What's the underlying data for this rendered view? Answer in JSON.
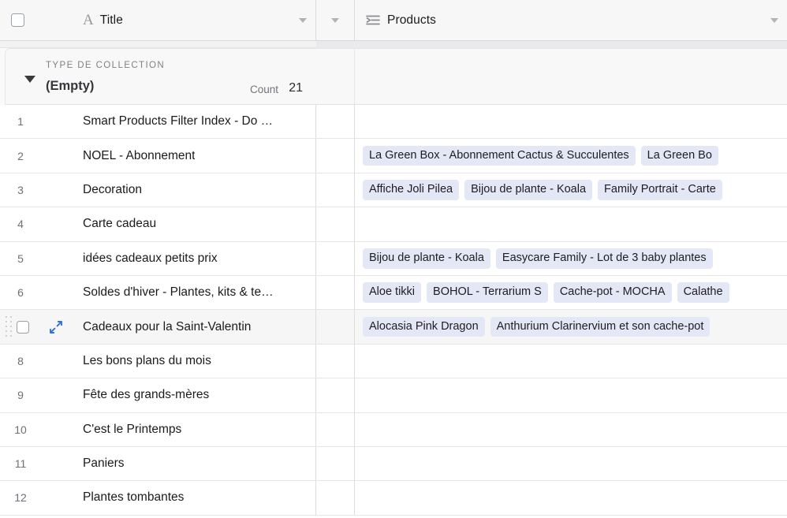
{
  "header": {
    "select_all_checkbox": "select-all",
    "columns": [
      {
        "label": "Title",
        "icon": "text-field-icon",
        "caret": "chevron-down-icon"
      },
      {
        "label": "",
        "icon": "",
        "caret": "chevron-down-icon"
      },
      {
        "label": "Products",
        "icon": "link-record-icon",
        "caret": "chevron-down-icon"
      }
    ]
  },
  "group": {
    "eyebrow": "TYPE DE COLLECTION",
    "value": "(Empty)",
    "count_label": "Count",
    "count_value": "21",
    "toggle": "collapse-triangle-icon"
  },
  "colors": {
    "tag_bg": "#e4e7f5",
    "tag_text": "#1d1d21",
    "accent_blue": "#2f6fe0",
    "row_selected_bg": "#f6f6f7",
    "header_bg": "#f7f7f8",
    "grid_line": "#e6e6e8"
  },
  "rows": [
    {
      "num": "1",
      "title": "Smart Products Filter Index - Do …",
      "selected": false,
      "products": []
    },
    {
      "num": "2",
      "title": "NOEL - Abonnement",
      "selected": false,
      "products": [
        "La Green Box - Abonnement Cactus & Succulentes",
        "La Green Bo"
      ]
    },
    {
      "num": "3",
      "title": "Decoration",
      "selected": false,
      "products": [
        "Affiche Joli Pilea",
        "Bijou de plante - Koala",
        "Family Portrait - Carte"
      ]
    },
    {
      "num": "4",
      "title": "Carte cadeau",
      "selected": false,
      "products": []
    },
    {
      "num": "5",
      "title": "idées cadeaux petits prix",
      "selected": false,
      "products": [
        "Bijou de plante - Koala",
        "Easycare Family - Lot de 3 baby plantes"
      ]
    },
    {
      "num": "6",
      "title": "Soldes d'hiver - Plantes, kits & te…",
      "selected": false,
      "products": [
        "Aloe tikki",
        "BOHOL - Terrarium S",
        "Cache-pot - MOCHA",
        "Calathe"
      ]
    },
    {
      "num": "7",
      "title": "Cadeaux pour la Saint-Valentin",
      "selected": true,
      "products": [
        "Alocasia Pink Dragon",
        "Anthurium Clarinervium et son cache-pot"
      ]
    },
    {
      "num": "8",
      "title": "Les bons plans du mois",
      "selected": false,
      "products": []
    },
    {
      "num": "9",
      "title": "Fête des grands-mères",
      "selected": false,
      "products": []
    },
    {
      "num": "10",
      "title": "C'est le Printemps",
      "selected": false,
      "products": []
    },
    {
      "num": "11",
      "title": "Paniers",
      "selected": false,
      "products": []
    },
    {
      "num": "12",
      "title": "Plantes tombantes",
      "selected": false,
      "products": []
    }
  ]
}
